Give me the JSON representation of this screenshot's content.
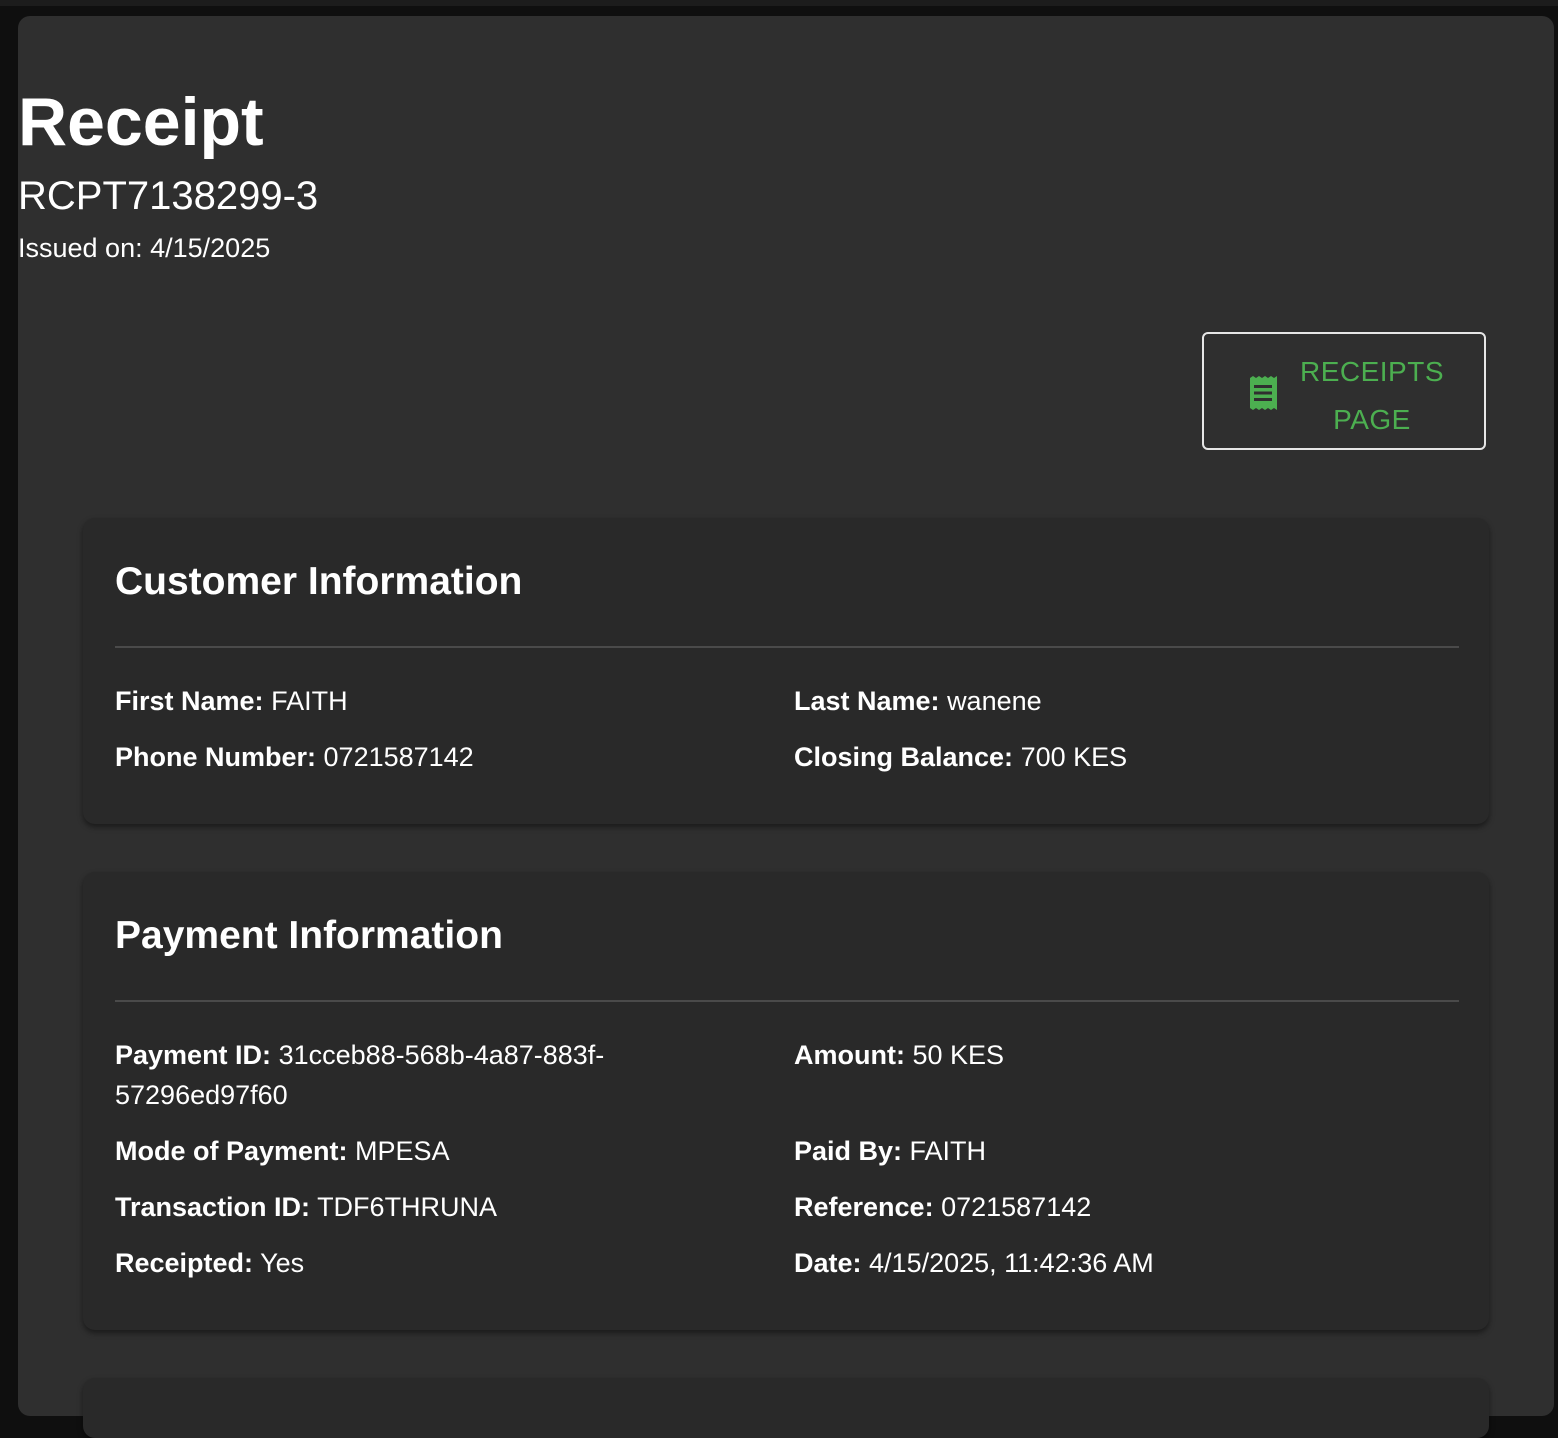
{
  "header": {
    "title": "Receipt",
    "receipt_number": "RCPT7138299-3",
    "issued_label": "Issued on:",
    "issued_date": "4/15/2025"
  },
  "actions": {
    "receipts_page_label_line1": "RECEIPTS",
    "receipts_page_label_line2": "PAGE",
    "receipts_page_icon": "receipt-icon",
    "accent_color": "#4caf50"
  },
  "customer": {
    "title": "Customer Information",
    "first_name_label": "First Name:",
    "first_name": "FAITH",
    "last_name_label": "Last Name:",
    "last_name": "wanene",
    "phone_label": "Phone Number:",
    "phone": "0721587142",
    "closing_balance_label": "Closing Balance:",
    "closing_balance": "700 KES"
  },
  "payment": {
    "title": "Payment Information",
    "payment_id_label": "Payment ID:",
    "payment_id": "31cceb88-568b-4a87-883f-57296ed97f60",
    "amount_label": "Amount:",
    "amount": "50 KES",
    "mode_label": "Mode of Payment:",
    "mode": "MPESA",
    "paid_by_label": "Paid By:",
    "paid_by": "FAITH",
    "transaction_id_label": "Transaction ID:",
    "transaction_id": "TDF6THRUNA",
    "reference_label": "Reference:",
    "reference": "0721587142",
    "receipted_label": "Receipted:",
    "receipted": "Yes",
    "date_label": "Date:",
    "date": "4/15/2025, 11:42:36 AM"
  }
}
